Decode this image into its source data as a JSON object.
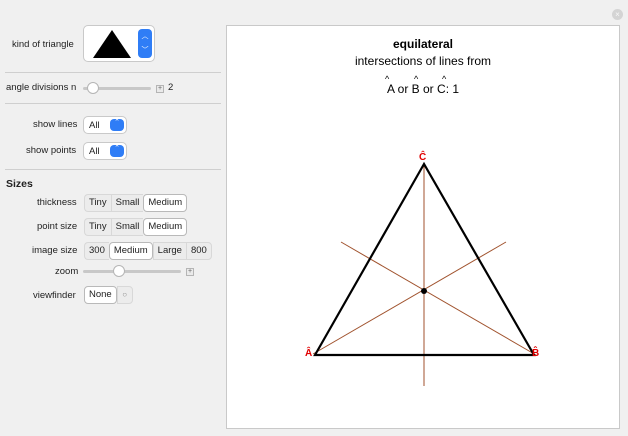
{
  "controls": {
    "kind_label": "kind of triangle",
    "angle_label": "angle divisions n",
    "angle_value": "2",
    "angle_fraction": 0.14,
    "show_lines_label": "show lines",
    "show_lines_value": "All",
    "show_points_label": "show points",
    "show_points_value": "All",
    "sizes_heading": "Sizes",
    "thickness_label": "thickness",
    "thickness_options": [
      "Tiny",
      "Small",
      "Medium"
    ],
    "thickness_selected": "Medium",
    "point_size_label": "point size",
    "point_size_options": [
      "Tiny",
      "Small",
      "Medium"
    ],
    "point_size_selected": "Medium",
    "image_size_label": "image size",
    "image_size_options": [
      "300",
      "Medium",
      "Large",
      "800"
    ],
    "image_size_selected": "Medium",
    "zoom_label": "zoom",
    "zoom_fraction": 0.37,
    "viewfinder_label": "viewfinder",
    "viewfinder_value": "None"
  },
  "plot": {
    "title": "equilateral",
    "subtitle": "intersections of lines from",
    "line3_prefix": "A or B or C: ",
    "line3_a": "A",
    "line3_or1": " or ",
    "line3_b": "B",
    "line3_or2": " or ",
    "line3_c": "C",
    "line3_suffix": ": 1",
    "hat": "^",
    "vertex_a": "Â",
    "vertex_b": "B̂",
    "vertex_c": "Ĉ",
    "colors": {
      "triangle": "#000000",
      "lines": "#a0522d",
      "vertex_labels": "#e00000",
      "intersection": "#000000"
    }
  }
}
